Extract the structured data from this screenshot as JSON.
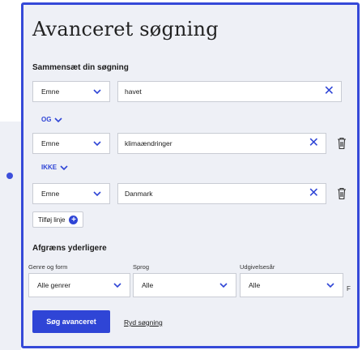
{
  "panel": {
    "title": "Avanceret søgning",
    "compose_label": "Sammensæt din søgning"
  },
  "rows": [
    {
      "field": "Emne",
      "value": "havet",
      "removable": false
    },
    {
      "operator": "OG",
      "field": "Emne",
      "value": "klimaændringer",
      "removable": true
    },
    {
      "operator": "IKKE",
      "field": "Emne",
      "value": "Danmark",
      "removable": true
    }
  ],
  "add_line_label": "Tilføj linje",
  "refine": {
    "label": "Afgræns yderligere",
    "filters": [
      {
        "label": "Genre og form",
        "value": "Alle genrer"
      },
      {
        "label": "Sprog",
        "value": "Alle"
      },
      {
        "label": "Udgivelsesår",
        "value": "Alle"
      }
    ],
    "overflow_char": "F"
  },
  "actions": {
    "search_label": "Søg avanceret",
    "simple_search_label": "Ryd søgning"
  },
  "colors": {
    "accent": "#2f45d6",
    "panel_border": "#3549d8",
    "panel_bg": "#eef0f6"
  },
  "icons": {
    "clear": "close-icon",
    "delete": "trash-icon",
    "dropdown": "chevron-down-icon",
    "add": "plus-circle-icon"
  }
}
